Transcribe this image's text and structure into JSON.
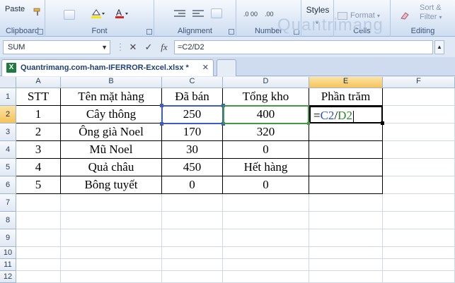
{
  "ribbon": {
    "groups": [
      {
        "label": "Clipboard"
      },
      {
        "label": "Font"
      },
      {
        "label": "Alignment"
      },
      {
        "label": "Number"
      },
      {
        "label": "Styles"
      },
      {
        "label": "Cells"
      },
      {
        "label": "Editing"
      }
    ],
    "paste_label": "Paste",
    "styles_label": "Styles",
    "format_label": "Format",
    "sort_label": "Sort &",
    "filter_label": "Filter",
    "watermark": "Quantrimang"
  },
  "formula_bar": {
    "name_box": "SUM",
    "fx": "fx",
    "formula": "=C2/D2"
  },
  "tabs": [
    {
      "label": "Quantrimang.com-ham-IFERROR-Excel.xlsx *"
    }
  ],
  "columns": [
    "A",
    "B",
    "C",
    "D",
    "E",
    "F"
  ],
  "rows": [
    "1",
    "2",
    "3",
    "4",
    "5",
    "6",
    "7",
    "8",
    "9",
    "10",
    "11",
    "12"
  ],
  "table": {
    "headers": [
      "STT",
      "Tên mặt hàng",
      "Đã bán",
      "Tổng kho",
      "Phần trăm"
    ],
    "data": [
      [
        "1",
        "Cây thông",
        "250",
        "400"
      ],
      [
        "2",
        "Ông già Noel",
        "170",
        "320"
      ],
      [
        "3",
        "Mũ Noel",
        "30",
        "0"
      ],
      [
        "4",
        "Quả châu",
        "450",
        "Hết hàng"
      ],
      [
        "5",
        "Bông tuyết",
        "0",
        "0"
      ]
    ],
    "edit_cell": {
      "eq": "=",
      "c": "C2",
      "slash": "/",
      "d": "D2"
    }
  },
  "colors": {
    "ref_c": "#2a58c9",
    "ref_d": "#2f8a2f",
    "active_header": "#f5c35a"
  }
}
